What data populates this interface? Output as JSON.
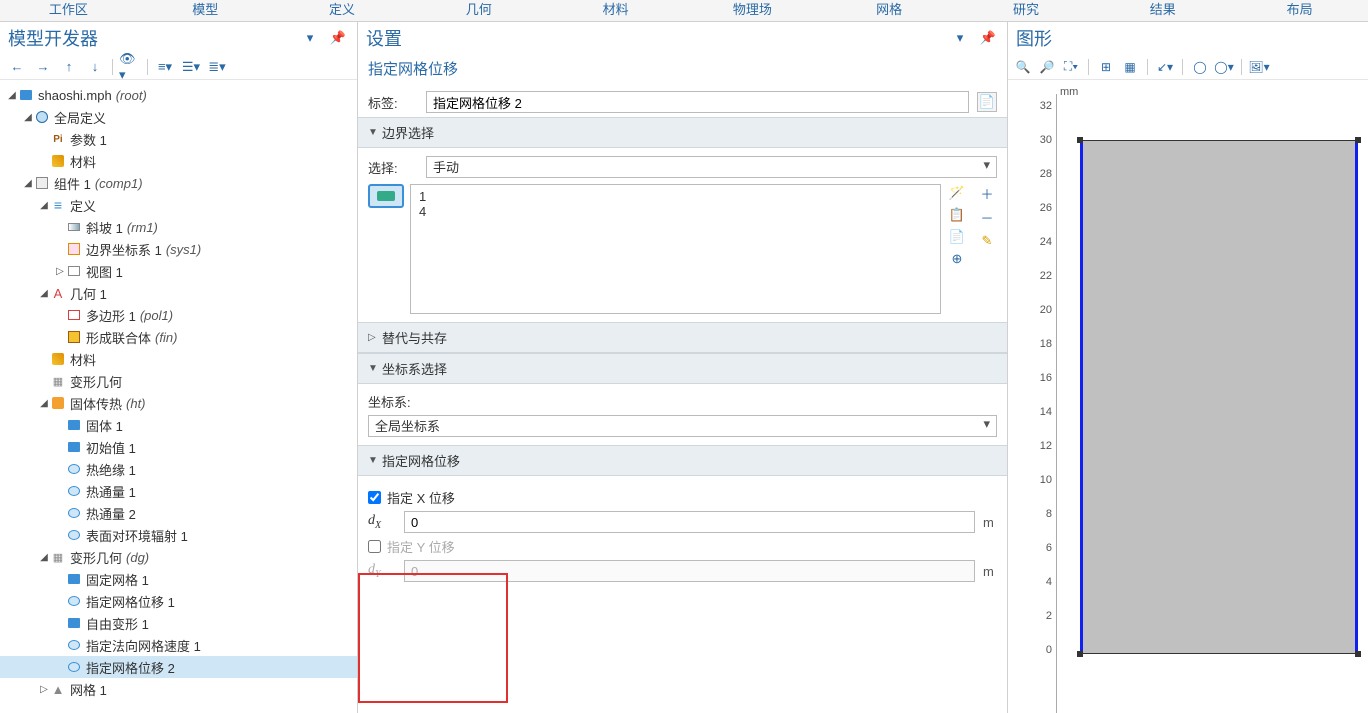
{
  "top_tabs": [
    "工作区",
    "模型",
    "定义",
    "几何",
    "材料",
    "物理场",
    "网格",
    "研究",
    "结果",
    "布局"
  ],
  "model_tree": {
    "title": "模型开发器",
    "root_label": "shaoshi.mph",
    "root_suffix": "(root)",
    "global_def": "全局定义",
    "params": "参数 1",
    "materials": "材料",
    "component": "组件 1",
    "component_suffix": "(comp1)",
    "definitions": "定义",
    "ramp": "斜坡 1",
    "ramp_suffix": "(rm1)",
    "bsys": "边界坐标系 1",
    "bsys_suffix": "(sys1)",
    "view": "视图 1",
    "geom": "几何 1",
    "poly": "多边形 1",
    "poly_suffix": "(pol1)",
    "union": "形成联合体",
    "union_suffix": "(fin)",
    "comp_materials": "材料",
    "dg1": "变形几何",
    "ht": "固体传热",
    "ht_suffix": "(ht)",
    "solid": "固体 1",
    "init": "初始值 1",
    "thins": "热绝缘 1",
    "hflux1": "热通量 1",
    "hflux2": "热通量 2",
    "surfrad": "表面对环境辐射 1",
    "dg2": "变形几何",
    "dg2_suffix": "(dg)",
    "fixedmesh": "固定网格 1",
    "pmd1": "指定网格位移 1",
    "freedef": "自由变形 1",
    "nvel": "指定法向网格速度 1",
    "pmd2": "指定网格位移 2",
    "mesh": "网格 1"
  },
  "settings": {
    "title": "设置",
    "subtitle": "指定网格位移",
    "label_label": "标签:",
    "label_value": "指定网格位移 2",
    "section_boundary": "边界选择",
    "select_label": "选择:",
    "select_value": "手动",
    "list": [
      "1",
      "4"
    ],
    "section_override": "替代与共存",
    "section_coord": "坐标系选择",
    "coord_label": "坐标系:",
    "coord_value": "全局坐标系",
    "section_disp": "指定网格位移",
    "chk_x": "指定 X 位移",
    "dx_label": "dX",
    "dx_value": "0",
    "chk_y": "指定 Y 位移",
    "dy_label": "dY",
    "dy_value": "0",
    "unit": "m"
  },
  "graphics": {
    "title": "图形",
    "unit": "mm",
    "y_ticks": [
      "32",
      "30",
      "28",
      "26",
      "24",
      "22",
      "20",
      "18",
      "16",
      "14",
      "12",
      "10",
      "8",
      "6",
      "4",
      "2",
      "0"
    ]
  }
}
